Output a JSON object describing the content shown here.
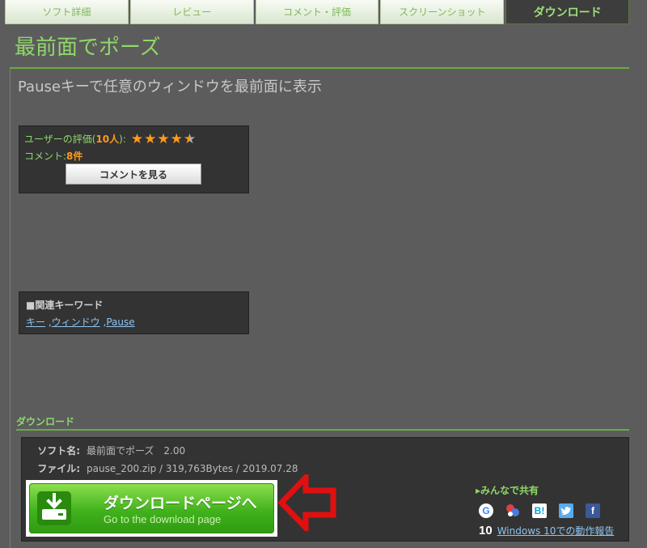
{
  "tabs": [
    {
      "label": "ソフト詳細"
    },
    {
      "label": "レビュー"
    },
    {
      "label": "コメント・評価"
    },
    {
      "label": "スクリーンショット"
    },
    {
      "label": "ダウンロード",
      "active": true
    }
  ],
  "page": {
    "title": "最前面でポーズ",
    "subtitle": "Pauseキーで任意のウィンドウを最前面に表示"
  },
  "rating": {
    "label_prefix": "ユーザーの評価(",
    "count": "10人",
    "label_suffix": "):",
    "stars": 4.5,
    "comments_prefix": "コメント:",
    "comments_count": "8件",
    "see_comments_button": "コメントを見る"
  },
  "keywords": {
    "title": "■関連キーワード",
    "items": [
      "キー",
      "ウィンドウ",
      "Pause"
    ]
  },
  "download": {
    "heading": "ダウンロード",
    "soft_name_label": "ソフト名:",
    "soft_name_value": "最前面でポーズ　2.00",
    "file_label": "ファイル:",
    "file_value": "pause_200.zip / 319,763Bytes / 2019.07.28",
    "button_main": "ダウンロードページへ",
    "button_sub": "Go to the download page"
  },
  "share": {
    "title": "みんなで共有",
    "icons": [
      "google-icon",
      "star-bookmark-icon",
      "hatena-bookmark-icon",
      "twitter-icon",
      "facebook-icon"
    ],
    "hatena_text": "B!",
    "facebook_text": "f",
    "google_text": "G",
    "win10_badge": "10",
    "win10_link": "Windows 10での動作報告"
  },
  "colors": {
    "accent_green": "#8fd86a",
    "orange": "#ff9a1a",
    "arrow_red": "#e01010"
  }
}
